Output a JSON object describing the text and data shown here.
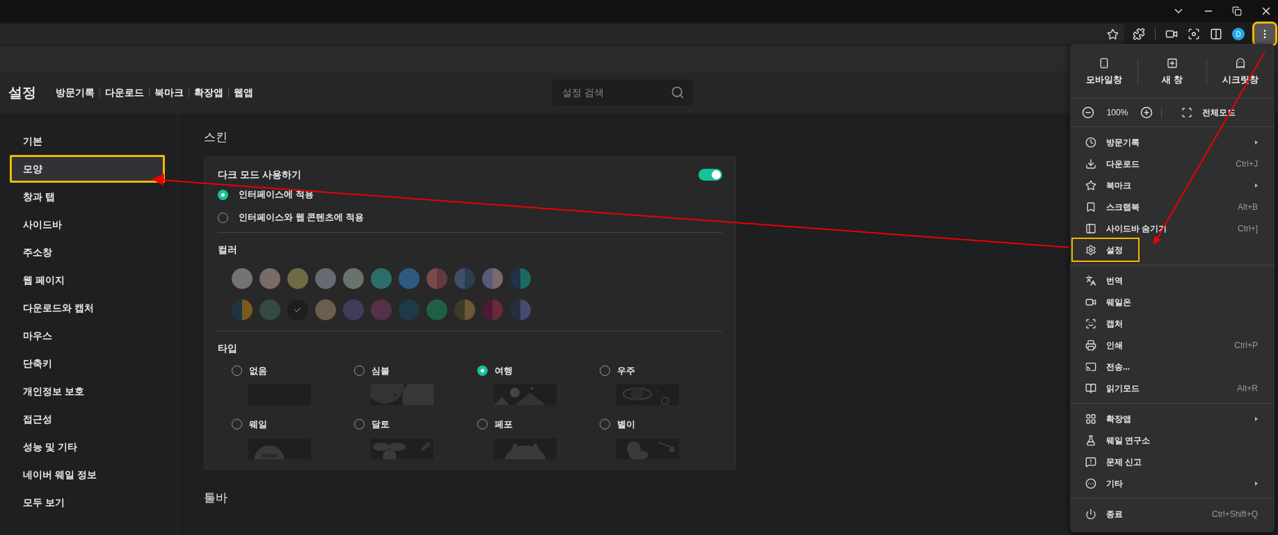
{
  "toolbar": {
    "avatar": "D",
    "menu_button_highlighted": true
  },
  "header": {
    "title": "설정",
    "links": [
      "방문기록",
      "다운로드",
      "북마크",
      "확장앱",
      "웹앱"
    ],
    "search": {
      "placeholder": "설정 검색"
    }
  },
  "sidebar": {
    "items": [
      {
        "label": "기본",
        "selected": false,
        "highlighted": false
      },
      {
        "label": "모양",
        "selected": true,
        "highlighted": true
      },
      {
        "label": "창과 탭",
        "selected": false,
        "highlighted": false
      },
      {
        "label": "사이드바",
        "selected": false,
        "highlighted": false
      },
      {
        "label": "주소창",
        "selected": false,
        "highlighted": false
      },
      {
        "label": "웹 페이지",
        "selected": false,
        "highlighted": false
      },
      {
        "label": "다운로드와 캡처",
        "selected": false,
        "highlighted": false
      },
      {
        "label": "마우스",
        "selected": false,
        "highlighted": false
      },
      {
        "label": "단축키",
        "selected": false,
        "highlighted": false
      },
      {
        "label": "개인정보 보호",
        "selected": false,
        "highlighted": false
      },
      {
        "label": "접근성",
        "selected": false,
        "highlighted": false
      },
      {
        "label": "성능 및 기타",
        "selected": false,
        "highlighted": false
      },
      {
        "label": "네이버 웨일 정보",
        "selected": false,
        "highlighted": false
      },
      {
        "label": "모두 보기",
        "selected": false,
        "highlighted": false
      }
    ]
  },
  "skin": {
    "title": "스킨",
    "dark_mode": {
      "label": "다크 모드 사용하기",
      "on": true
    },
    "apply_options": [
      {
        "label": "인터페이스에 적용",
        "selected": true
      },
      {
        "label": "인터페이스와 웹 콘텐츠에 적용",
        "selected": false
      }
    ],
    "color_title": "컬러",
    "colors": [
      {
        "kind": "solid",
        "color": "#737373",
        "selected": false
      },
      {
        "kind": "solid",
        "color": "#7a6a68",
        "selected": false
      },
      {
        "kind": "solid",
        "color": "#6f6c45",
        "selected": false
      },
      {
        "kind": "solid",
        "color": "#676a73",
        "selected": false
      },
      {
        "kind": "solid",
        "color": "#6a736b",
        "selected": false
      },
      {
        "kind": "solid",
        "color": "#2d6e68",
        "selected": false
      },
      {
        "kind": "solid",
        "color": "#2e5a80",
        "selected": false
      },
      {
        "kind": "split",
        "halves": [
          {
            "color": "#7a4a4a"
          },
          {
            "color": "#633a40"
          }
        ],
        "selected": false
      },
      {
        "kind": "split",
        "halves": [
          {
            "color": "#3d5068"
          },
          {
            "color": "#2b3d50"
          }
        ],
        "selected": false
      },
      {
        "kind": "split",
        "halves": [
          {
            "color": "#5a5a7a"
          },
          {
            "color": "#7a6a6a"
          }
        ],
        "selected": false
      },
      {
        "kind": "split",
        "halves": [
          {
            "color": "#23304a"
          },
          {
            "color": "#1a6a60"
          }
        ],
        "selected": false
      },
      {
        "kind": "split",
        "halves": [
          {
            "color": "#1d3545"
          },
          {
            "color": "#7a5a1e"
          }
        ],
        "selected": false
      },
      {
        "kind": "solid",
        "color": "#354a40",
        "selected": false
      },
      {
        "kind": "solid",
        "color": "#1e1e1e",
        "selected": true
      },
      {
        "kind": "solid",
        "color": "#6b5e4c",
        "selected": false
      },
      {
        "kind": "solid",
        "color": "#403d5a",
        "selected": false
      },
      {
        "kind": "solid",
        "color": "#553048",
        "selected": false
      },
      {
        "kind": "solid",
        "color": "#1e3a48",
        "selected": false
      },
      {
        "kind": "solid",
        "color": "#1e6045",
        "selected": false
      },
      {
        "kind": "split",
        "halves": [
          {
            "color": "#3d3a28"
          },
          {
            "color": "#6b5838"
          }
        ],
        "selected": false
      },
      {
        "kind": "split",
        "halves": [
          {
            "color": "#4a1a38"
          },
          {
            "color": "#6a2a38"
          }
        ],
        "selected": false
      },
      {
        "kind": "split",
        "halves": [
          {
            "color": "#2a2d3d"
          },
          {
            "color": "#454a70"
          }
        ],
        "selected": false
      }
    ],
    "type_title": "타입",
    "types": [
      {
        "label": "없음",
        "selected": false
      },
      {
        "label": "심볼",
        "selected": false
      },
      {
        "label": "여행",
        "selected": true
      },
      {
        "label": "우주",
        "selected": false
      },
      {
        "label": "웨일",
        "selected": false
      },
      {
        "label": "달토",
        "selected": false
      },
      {
        "label": "페포",
        "selected": false
      },
      {
        "label": "별이",
        "selected": false
      }
    ]
  },
  "next_section": "툴바",
  "menu": {
    "top_buttons": [
      "모바일창",
      "새 창",
      "시크릿창"
    ],
    "zoom": "100%",
    "fullscreen": "전체모드",
    "groups": [
      [
        {
          "label": "방문기록",
          "has_submenu": true,
          "highlighted": false
        },
        {
          "label": "다운로드",
          "shortcut": "Ctrl+J",
          "has_submenu": false,
          "highlighted": false
        },
        {
          "label": "북마크",
          "has_submenu": true,
          "highlighted": false
        },
        {
          "label": "스크랩북",
          "shortcut": "Alt+B",
          "has_submenu": false,
          "highlighted": false
        },
        {
          "label": "사이드바 숨기기",
          "shortcut": "Ctrl+]",
          "has_submenu": false,
          "highlighted": false
        },
        {
          "label": "설정",
          "has_submenu": false,
          "highlighted": true
        }
      ],
      [
        {
          "label": "번역",
          "has_submenu": false,
          "highlighted": false
        },
        {
          "label": "웨일온",
          "has_submenu": false,
          "highlighted": false
        },
        {
          "label": "캡처",
          "has_submenu": false,
          "highlighted": false
        },
        {
          "label": "인쇄",
          "shortcut": "Ctrl+P",
          "has_submenu": false,
          "highlighted": false
        },
        {
          "label": "전송...",
          "has_submenu": false,
          "highlighted": false
        },
        {
          "label": "읽기모드",
          "shortcut": "Alt+R",
          "has_submenu": false,
          "highlighted": false
        }
      ],
      [
        {
          "label": "확장앱",
          "has_submenu": true,
          "highlighted": false
        },
        {
          "label": "웨일 연구소",
          "has_submenu": false,
          "highlighted": false
        },
        {
          "label": "문제 신고",
          "has_submenu": false,
          "highlighted": false
        },
        {
          "label": "기타",
          "has_submenu": true,
          "highlighted": false
        }
      ],
      [
        {
          "label": "종료",
          "shortcut": "Ctrl+Shift+Q",
          "has_submenu": false,
          "highlighted": false
        }
      ]
    ]
  }
}
